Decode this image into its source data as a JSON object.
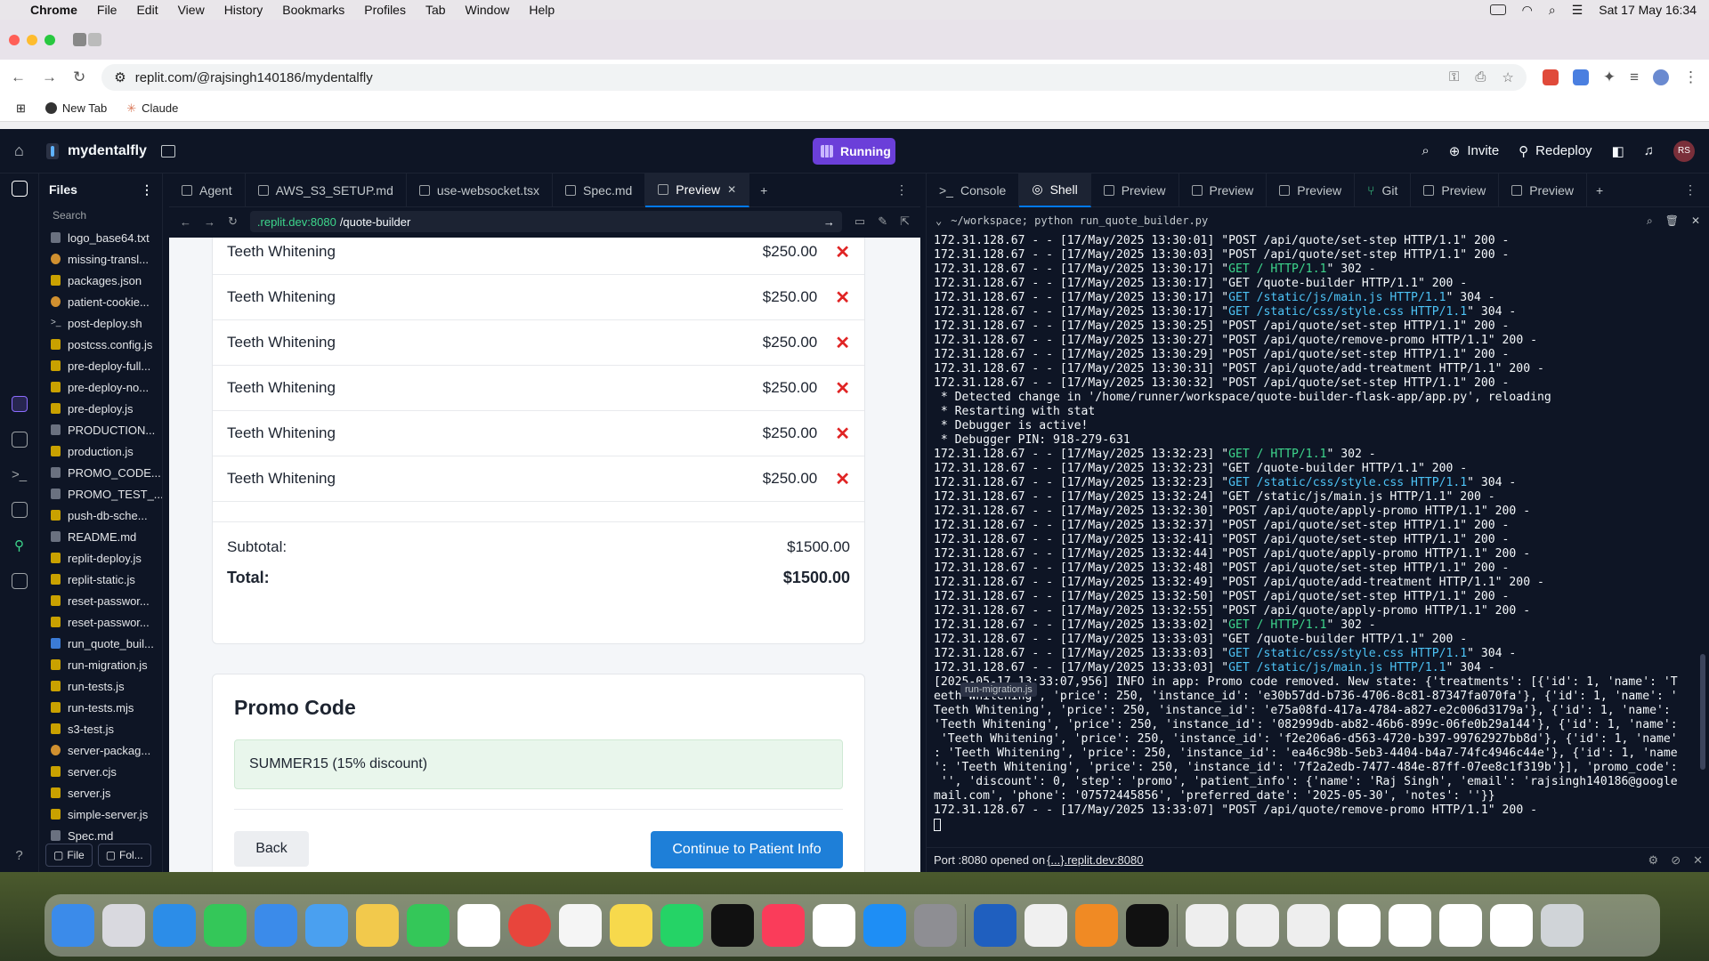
{
  "menubar": {
    "app": "Chrome",
    "items": [
      "File",
      "Edit",
      "View",
      "History",
      "Bookmarks",
      "Profiles",
      "Tab",
      "Window",
      "Help"
    ],
    "clock": "Sat 17 May  16:34"
  },
  "browser": {
    "url": "replit.com/@rajsingh140186/mydentalfly",
    "bookmarks": [
      "New Tab",
      "Claude"
    ]
  },
  "replit": {
    "project_name": "mydentalfly",
    "run_status": "Running",
    "invite_label": "Invite",
    "redeploy_label": "Redeploy",
    "avatar_initials": "RS",
    "files_title": "Files",
    "search_placeholder": "Search",
    "files": [
      {
        "name": "logo_base64.txt",
        "type": "txt"
      },
      {
        "name": "missing-transl...",
        "type": "cfg"
      },
      {
        "name": "packages.json",
        "type": "json"
      },
      {
        "name": "patient-cookie...",
        "type": "cfg"
      },
      {
        "name": "post-deploy.sh",
        "type": "sh"
      },
      {
        "name": "postcss.config.js",
        "type": "js"
      },
      {
        "name": "pre-deploy-full...",
        "type": "js"
      },
      {
        "name": "pre-deploy-no...",
        "type": "js"
      },
      {
        "name": "pre-deploy.js",
        "type": "js"
      },
      {
        "name": "PRODUCTION...",
        "type": "md"
      },
      {
        "name": "production.js",
        "type": "js"
      },
      {
        "name": "PROMO_CODE...",
        "type": "md"
      },
      {
        "name": "PROMO_TEST_...",
        "type": "md"
      },
      {
        "name": "push-db-sche...",
        "type": "js"
      },
      {
        "name": "README.md",
        "type": "md"
      },
      {
        "name": "replit-deploy.js",
        "type": "js"
      },
      {
        "name": "replit-static.js",
        "type": "js"
      },
      {
        "name": "reset-passwor...",
        "type": "js"
      },
      {
        "name": "reset-passwor...",
        "type": "js"
      },
      {
        "name": "run_quote_buil...",
        "type": "py"
      },
      {
        "name": "run-migration.js",
        "type": "js"
      },
      {
        "name": "run-tests.js",
        "type": "js"
      },
      {
        "name": "run-tests.mjs",
        "type": "js"
      },
      {
        "name": "s3-test.js",
        "type": "js"
      },
      {
        "name": "server-packag...",
        "type": "cfg"
      },
      {
        "name": "server.cjs",
        "type": "js"
      },
      {
        "name": "server.js",
        "type": "js"
      },
      {
        "name": "simple-server.js",
        "type": "js"
      },
      {
        "name": "Spec.md",
        "type": "md"
      }
    ],
    "footer_buttons": [
      "File",
      "Fol..."
    ],
    "left_tabs": [
      "Agent",
      "AWS_S3_SETUP.md",
      "use-websocket.tsx",
      "Spec.md",
      "Preview"
    ],
    "right_tabs": [
      "Console",
      "Shell",
      "Preview",
      "Preview",
      "Preview",
      "Git",
      "Preview",
      "Preview"
    ],
    "preview_url_host": ".replit.dev:8080",
    "preview_url_path": "/quote-builder",
    "shell_path": "~/workspace; python run_quote_builder.py",
    "port_message": "Port :8080 opened on ",
    "port_link": "{...}.replit.dev:8080",
    "tooltip": "run-migration.js"
  },
  "quote": {
    "treatments": [
      {
        "name": "Teeth Whitening",
        "price": "$250.00"
      },
      {
        "name": "Teeth Whitening",
        "price": "$250.00"
      },
      {
        "name": "Teeth Whitening",
        "price": "$250.00"
      },
      {
        "name": "Teeth Whitening",
        "price": "$250.00"
      },
      {
        "name": "Teeth Whitening",
        "price": "$250.00"
      },
      {
        "name": "Teeth Whitening",
        "price": "$250.00"
      }
    ],
    "subtotal_label": "Subtotal:",
    "subtotal_value": "$1500.00",
    "total_label": "Total:",
    "total_value": "$1500.00",
    "promo_title": "Promo Code",
    "promo_applied": "SUMMER15 (15% discount)",
    "back_label": "Back",
    "continue_label": "Continue to Patient Info"
  },
  "terminal_lines": [
    {
      "pre": "172.31.128.67 - - [17/May/2025 13:30:01] \"",
      "req": "POST /api/quote/set-step HTTP/1.1",
      "post": "\" 200 -",
      "color": ""
    },
    {
      "pre": "172.31.128.67 - - [17/May/2025 13:30:03] \"",
      "req": "POST /api/quote/set-step HTTP/1.1",
      "post": "\" 200 -",
      "color": ""
    },
    {
      "pre": "172.31.128.67 - - [17/May/2025 13:30:17] \"",
      "req": "GET / HTTP/1.1",
      "post": "\" 302 -",
      "color": "hl"
    },
    {
      "pre": "172.31.128.67 - - [17/May/2025 13:30:17] \"",
      "req": "GET /quote-builder HTTP/1.1",
      "post": "\" 200 -",
      "color": ""
    },
    {
      "pre": "172.31.128.67 - - [17/May/2025 13:30:17] \"",
      "req": "GET /static/js/main.js HTTP/1.1",
      "post": "\" 304 -",
      "color": "hlc"
    },
    {
      "pre": "172.31.128.67 - - [17/May/2025 13:30:17] \"",
      "req": "GET /static/css/style.css HTTP/1.1",
      "post": "\" 304 -",
      "color": "hlc"
    },
    {
      "pre": "172.31.128.67 - - [17/May/2025 13:30:25] \"",
      "req": "POST /api/quote/set-step HTTP/1.1",
      "post": "\" 200 -",
      "color": ""
    },
    {
      "pre": "172.31.128.67 - - [17/May/2025 13:30:27] \"",
      "req": "POST /api/quote/remove-promo HTTP/1.1",
      "post": "\" 200 -",
      "color": ""
    },
    {
      "pre": "172.31.128.67 - - [17/May/2025 13:30:29] \"",
      "req": "POST /api/quote/set-step HTTP/1.1",
      "post": "\" 200 -",
      "color": ""
    },
    {
      "pre": "172.31.128.67 - - [17/May/2025 13:30:31] \"",
      "req": "POST /api/quote/add-treatment HTTP/1.1",
      "post": "\" 200 -",
      "color": ""
    },
    {
      "pre": "172.31.128.67 - - [17/May/2025 13:30:32] \"",
      "req": "POST /api/quote/set-step HTTP/1.1",
      "post": "\" 200 -",
      "color": ""
    },
    {
      "pre": " * Detected change in '/home/runner/workspace/quote-builder-flask-app/app.py', reloading",
      "req": "",
      "post": "",
      "color": ""
    },
    {
      "pre": " * Restarting with stat",
      "req": "",
      "post": "",
      "color": ""
    },
    {
      "pre": " * Debugger is active!",
      "req": "",
      "post": "",
      "color": ""
    },
    {
      "pre": " * Debugger PIN: 918-279-631",
      "req": "",
      "post": "",
      "color": ""
    },
    {
      "pre": "172.31.128.67 - - [17/May/2025 13:32:23] \"",
      "req": "GET / HTTP/1.1",
      "post": "\" 302 -",
      "color": "hl"
    },
    {
      "pre": "172.31.128.67 - - [17/May/2025 13:32:23] \"",
      "req": "GET /quote-builder HTTP/1.1",
      "post": "\" 200 -",
      "color": ""
    },
    {
      "pre": "172.31.128.67 - - [17/May/2025 13:32:23] \"",
      "req": "GET /static/css/style.css HTTP/1.1",
      "post": "\" 304 -",
      "color": "hlc"
    },
    {
      "pre": "172.31.128.67 - - [17/May/2025 13:32:24] \"",
      "req": "GET /static/js/main.js HTTP/1.1",
      "post": "\" 200 -",
      "color": ""
    },
    {
      "pre": "172.31.128.67 - - [17/May/2025 13:32:30] \"",
      "req": "POST /api/quote/apply-promo HTTP/1.1",
      "post": "\" 200 -",
      "color": ""
    },
    {
      "pre": "172.31.128.67 - - [17/May/2025 13:32:37] \"",
      "req": "POST /api/quote/set-step HTTP/1.1",
      "post": "\" 200 -",
      "color": ""
    },
    {
      "pre": "172.31.128.67 - - [17/May/2025 13:32:41] \"",
      "req": "POST /api/quote/set-step HTTP/1.1",
      "post": "\" 200 -",
      "color": ""
    },
    {
      "pre": "172.31.128.67 - - [17/May/2025 13:32:44] \"",
      "req": "POST /api/quote/apply-promo HTTP/1.1",
      "post": "\" 200 -",
      "color": ""
    },
    {
      "pre": "172.31.128.67 - - [17/May/2025 13:32:48] \"",
      "req": "POST /api/quote/set-step HTTP/1.1",
      "post": "\" 200 -",
      "color": ""
    },
    {
      "pre": "172.31.128.67 - - [17/May/2025 13:32:49] \"",
      "req": "POST /api/quote/add-treatment HTTP/1.1",
      "post": "\" 200 -",
      "color": ""
    },
    {
      "pre": "172.31.128.67 - - [17/May/2025 13:32:50] \"",
      "req": "POST /api/quote/set-step HTTP/1.1",
      "post": "\" 200 -",
      "color": ""
    },
    {
      "pre": "172.31.128.67 - - [17/May/2025 13:32:55] \"",
      "req": "POST /api/quote/apply-promo HTTP/1.1",
      "post": "\" 200 -",
      "color": ""
    },
    {
      "pre": "172.31.128.67 - - [17/May/2025 13:33:02] \"",
      "req": "GET / HTTP/1.1",
      "post": "\" 302 -",
      "color": "hl"
    },
    {
      "pre": "172.31.128.67 - - [17/May/2025 13:33:03] \"",
      "req": "GET /quote-builder HTTP/1.1",
      "post": "\" 200 -",
      "color": ""
    },
    {
      "pre": "172.31.128.67 - - [17/May/2025 13:33:03] \"",
      "req": "GET /static/css/style.css HTTP/1.1",
      "post": "\" 304 -",
      "color": "hlc"
    },
    {
      "pre": "172.31.128.67 - - [17/May/2025 13:33:03] \"",
      "req": "GET /static/js/main.js HTTP/1.1",
      "post": "\" 304 -",
      "color": "hlc"
    },
    {
      "pre": "[2025-05-17 13:33:07,956] INFO in app: Promo code removed. New state: {'treatments': [{'id': 1, 'name': 'T",
      "req": "",
      "post": "",
      "color": ""
    },
    {
      "pre": "eeth Whitening', 'price': 250, 'instance_id': 'e30b57dd-b736-4706-8c81-87347fa070fa'}, {'id': 1, 'name': '",
      "req": "",
      "post": "",
      "color": ""
    },
    {
      "pre": "Teeth Whitening', 'price': 250, 'instance_id': 'e75a08fd-417a-4784-a827-e2c006d3179a'}, {'id': 1, 'name': ",
      "req": "",
      "post": "",
      "color": ""
    },
    {
      "pre": "'Teeth Whitening', 'price': 250, 'instance_id': '082999db-ab82-46b6-899c-06fe0b29a144'}, {'id': 1, 'name':",
      "req": "",
      "post": "",
      "color": ""
    },
    {
      "pre": " 'Teeth Whitening', 'price': 250, 'instance_id': 'f2e206a6-d563-4720-b397-99762927bb8d'}, {'id': 1, 'name'",
      "req": "",
      "post": "",
      "color": ""
    },
    {
      "pre": ": 'Teeth Whitening', 'price': 250, 'instance_id': 'ea46c98b-5eb3-4404-b4a7-74fc4946c44e'}, {'id': 1, 'name",
      "req": "",
      "post": "",
      "color": ""
    },
    {
      "pre": "': 'Teeth Whitening', 'price': 250, 'instance_id': '7f2a2edb-7477-484e-87ff-07ee8c1f319b'}], 'promo_code':",
      "req": "",
      "post": "",
      "color": ""
    },
    {
      "pre": " '', 'discount': 0, 'step': 'promo', 'patient_info': {'name': 'Raj Singh', 'email': 'rajsingh140186@google",
      "req": "",
      "post": "",
      "color": ""
    },
    {
      "pre": "mail.com', 'phone': '07572445856', 'preferred_date': '2025-05-30', 'notes': ''}}",
      "req": "",
      "post": "",
      "color": ""
    },
    {
      "pre": "172.31.128.67 - - [17/May/2025 13:33:07] \"",
      "req": "POST /api/quote/remove-promo HTTP/1.1",
      "post": "\" 200 -",
      "color": ""
    }
  ]
}
